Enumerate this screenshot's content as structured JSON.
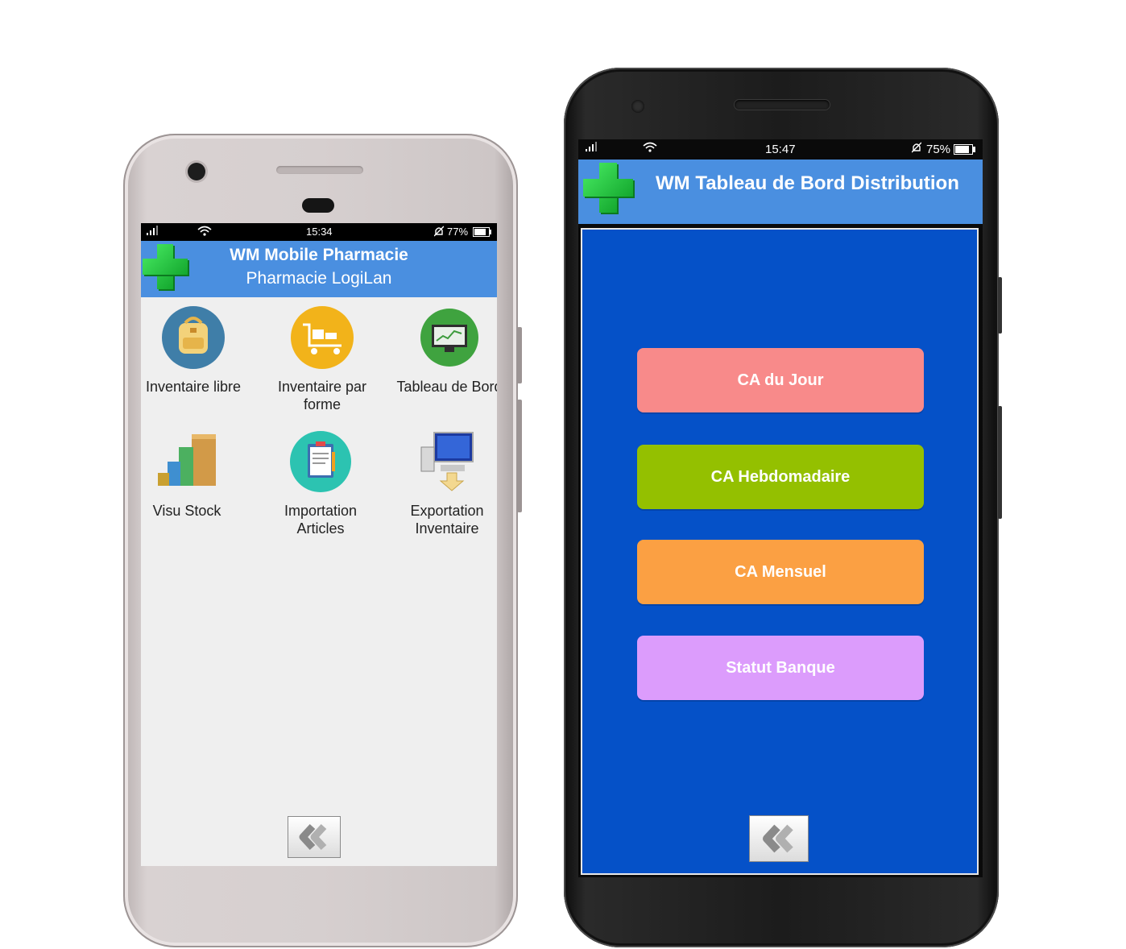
{
  "phone_left": {
    "status_bar": {
      "time": "15:34",
      "battery": "77%"
    },
    "header": {
      "title": "WM Mobile Pharmacie",
      "subtitle": "Pharmacie LogiLan"
    },
    "tiles": [
      {
        "label": "Inventaire libre",
        "icon": "backpack-icon"
      },
      {
        "label": "Inventaire par forme",
        "icon": "cart-boxes-icon"
      },
      {
        "label": "Tableau de Bord",
        "icon": "monitor-chart-icon"
      },
      {
        "label": "Visu Stock",
        "icon": "stacked-boxes-icon"
      },
      {
        "label": "Importation Articles",
        "icon": "clipboard-icon"
      },
      {
        "label": "Exportation Inventaire",
        "icon": "computer-export-icon"
      }
    ]
  },
  "phone_right": {
    "status_bar": {
      "time": "15:47",
      "battery": "75%"
    },
    "header": {
      "title": "WM Tableau de Bord Distribution"
    },
    "buttons": [
      {
        "label": "CA du Jour",
        "color": "#f88a8a"
      },
      {
        "label": "CA Hebdomadaire",
        "color": "#94c000"
      },
      {
        "label": "CA Mensuel",
        "color": "#fba043"
      },
      {
        "label": "Statut Banque",
        "color": "#dc9cfc"
      }
    ]
  },
  "colors": {
    "header_blue": "#4a8fe0",
    "dashboard_blue": "#0551c8",
    "cross_green": "#2bd045"
  }
}
